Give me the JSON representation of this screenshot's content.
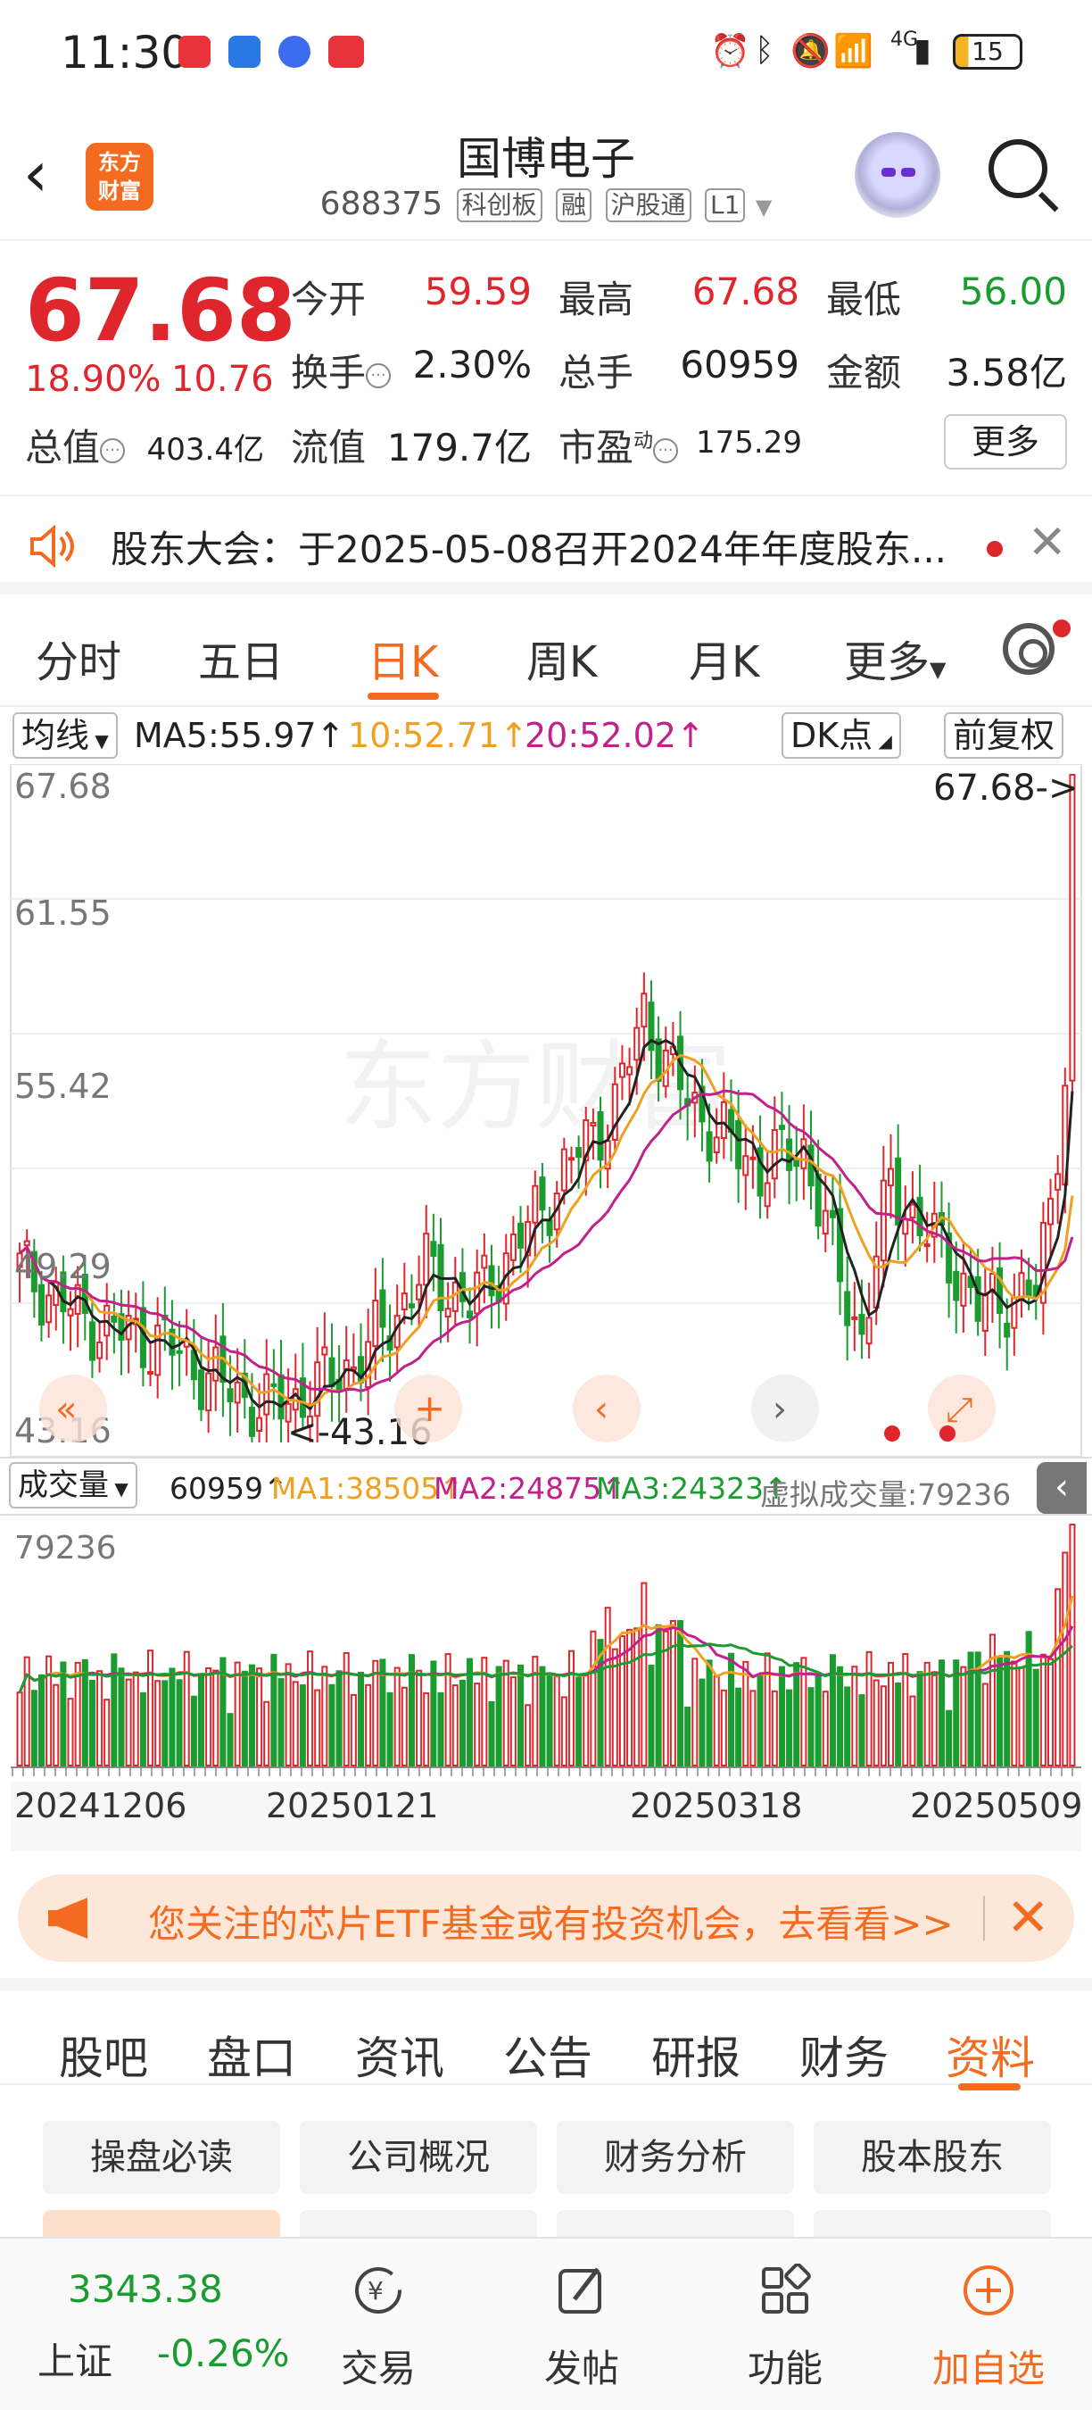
{
  "status_bar": {
    "time": "11:30",
    "network": "4G",
    "battery": "15"
  },
  "header": {
    "title": "国博电子",
    "code": "688375",
    "tags": [
      "科创板",
      "融",
      "沪股通",
      "L1"
    ],
    "logo_line1": "东方",
    "logo_line2": "财富"
  },
  "quote": {
    "price": "67.68",
    "pct": "18.90%",
    "change": "10.76",
    "open_label": "今开",
    "open": "59.59",
    "high_label": "最高",
    "high": "67.68",
    "low_label": "最低",
    "low": "56.00",
    "turnover_label": "换手",
    "turnover": "2.30%",
    "volume_label": "总手",
    "volume": "60959",
    "amount_label": "金额",
    "amount": "3.58亿",
    "mcap_label": "总值",
    "mcap": "403.4亿",
    "float_label": "流值",
    "float_cap": "179.7亿",
    "pe_label": "市盈",
    "pe_sup": "动",
    "pe": "175.29",
    "more": "更多"
  },
  "notice": {
    "text": "股东大会：于2025-05-08召开2024年年度股东..."
  },
  "period_tabs": [
    "分时",
    "五日",
    "日K",
    "周K",
    "月K",
    "更多"
  ],
  "ma_row": {
    "selector": "均线",
    "ma5": "MA5:55.97↑",
    "ma10": "10:52.71↑",
    "ma20": "20:52.02↑",
    "dk": "DK点",
    "adjust": "前复权"
  },
  "chart_data": {
    "type": "candlestick",
    "y_ticks": [
      "67.68",
      "61.55",
      "55.42",
      "49.29",
      "43.16"
    ],
    "ylim": [
      43.16,
      67.68
    ],
    "last_label": "67.68->",
    "low_label": "<-43.16",
    "watermark": "东方财富",
    "x_labels": [
      "20241206",
      "20250121",
      "20250318",
      "20250509"
    ],
    "vol_max_label": "79236",
    "colors": {
      "up": "#e0262d",
      "down": "#1a9c30",
      "ma5": "#222222",
      "ma10": "#f0a020",
      "ma20": "#c2208a",
      "vol_ma1": "#f0a020",
      "vol_ma2": "#c2208a",
      "vol_ma3": "#1a9c30"
    }
  },
  "vol_row": {
    "selector": "成交量",
    "vol": "60959↑",
    "ma1": "MA1:38505↑",
    "ma2": "MA2:24875↑",
    "ma3": "MA3:24323↑",
    "virtual": "虚拟成交量:79236"
  },
  "banner": {
    "text": "您关注的芯片ETF基金或有投资机会，去看看>>"
  },
  "bottom_tabs": [
    "股吧",
    "盘口",
    "资讯",
    "公告",
    "研报",
    "财务",
    "资料"
  ],
  "grid_buttons": [
    "操盘必读",
    "公司概况",
    "财务分析",
    "股本股东"
  ],
  "bottom_nav": {
    "index_value": "3343.38",
    "index_name": "上证",
    "index_pct": "-0.26%",
    "trade": "交易",
    "post": "发帖",
    "func": "功能",
    "add": "加自选"
  }
}
